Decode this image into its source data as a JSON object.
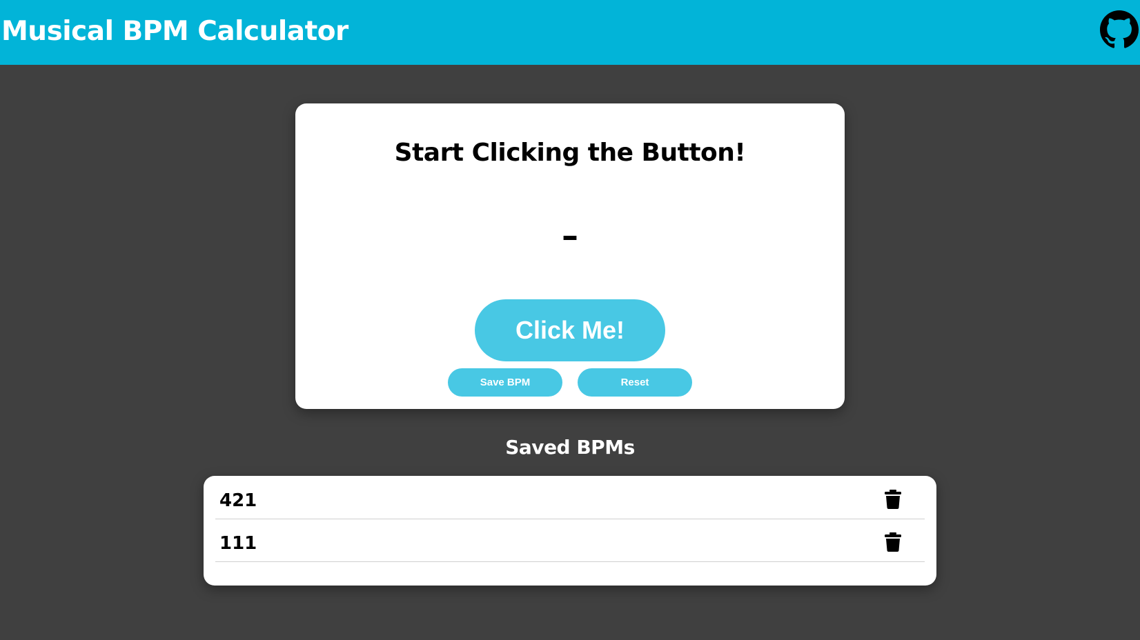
{
  "header": {
    "title": "Musical BPM Calculator",
    "github_icon": "github-icon",
    "background_color": "#02b4d8"
  },
  "calculator": {
    "heading": "Start Clicking the Button!",
    "bpm_display": "–",
    "click_button_label": "Click Me!",
    "save_button_label": "Save BPM",
    "reset_button_label": "Reset",
    "accent_color": "#48c8e4"
  },
  "saved": {
    "heading": "Saved BPMs",
    "items": [
      {
        "value": "421",
        "delete_icon": "trash-icon"
      },
      {
        "value": "111",
        "delete_icon": "trash-icon"
      }
    ]
  },
  "colors": {
    "page_background": "#404040",
    "card_background": "#ffffff"
  }
}
